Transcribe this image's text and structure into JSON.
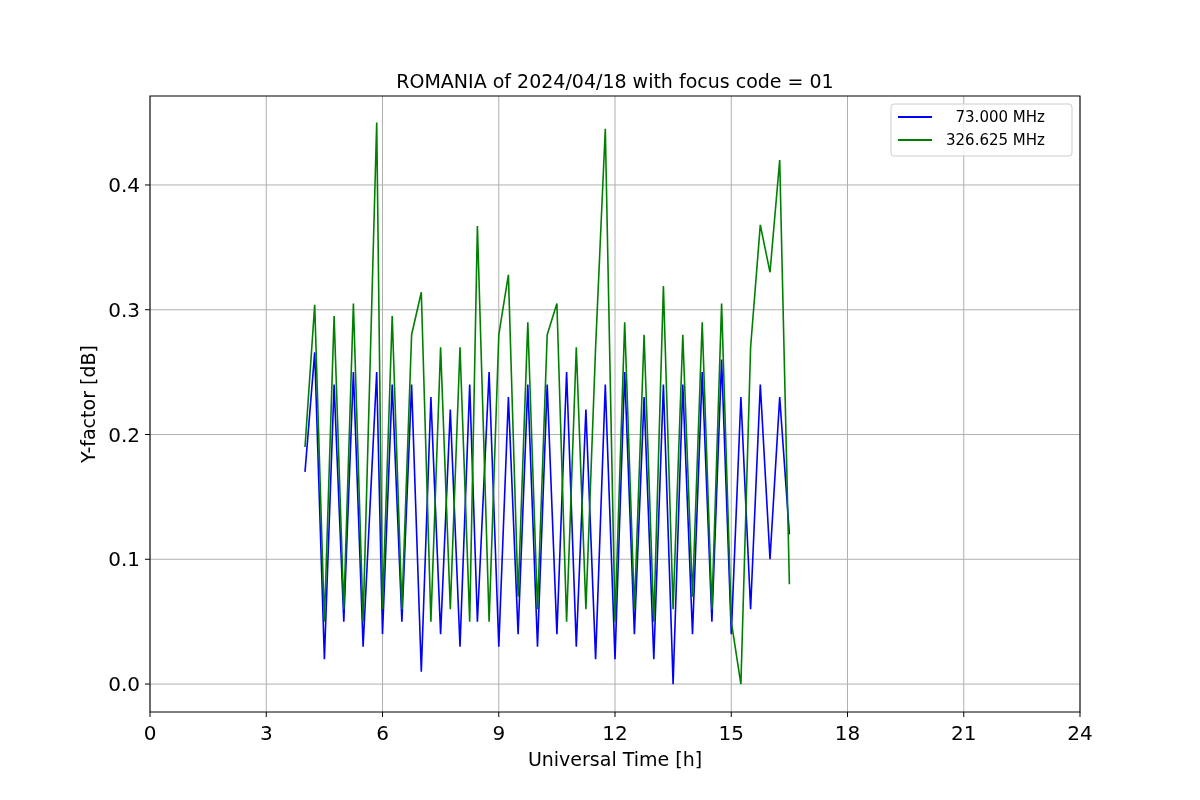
{
  "chart_data": {
    "type": "line",
    "title": "ROMANIA of 2024/04/18 with focus code = 01",
    "xlabel": "Universal Time [h]",
    "ylabel": "Y-factor [dB]",
    "x": [
      4.0,
      4.25,
      4.5,
      4.75,
      5.0,
      5.25,
      5.5,
      5.85,
      6.0,
      6.25,
      6.5,
      6.75,
      7.0,
      7.25,
      7.5,
      7.75,
      8.0,
      8.25,
      8.45,
      8.75,
      9.0,
      9.25,
      9.5,
      9.75,
      10.0,
      10.25,
      10.5,
      10.75,
      11.0,
      11.25,
      11.5,
      11.75,
      12.0,
      12.25,
      12.5,
      12.75,
      13.0,
      13.25,
      13.5,
      13.75,
      14.0,
      14.25,
      14.5,
      14.75,
      15.0,
      15.25,
      15.5,
      15.75,
      16.0,
      16.25,
      16.5
    ],
    "series": [
      {
        "name": "  73.000 MHz",
        "color": "#0000ff",
        "values": [
          0.17,
          0.266,
          0.02,
          0.24,
          0.05,
          0.25,
          0.03,
          0.25,
          0.04,
          0.24,
          0.05,
          0.24,
          0.01,
          0.23,
          0.04,
          0.22,
          0.03,
          0.24,
          0.05,
          0.25,
          0.03,
          0.23,
          0.04,
          0.24,
          0.03,
          0.24,
          0.04,
          0.25,
          0.03,
          0.22,
          0.02,
          0.24,
          0.02,
          0.25,
          0.04,
          0.23,
          0.02,
          0.24,
          0.0,
          0.24,
          0.04,
          0.25,
          0.05,
          0.26,
          0.04,
          0.23,
          0.06,
          0.24,
          0.1,
          0.23,
          0.12
        ]
      },
      {
        "name": "326.625 MHz",
        "color": "#008000",
        "values": [
          0.19,
          0.304,
          0.05,
          0.295,
          0.06,
          0.305,
          0.05,
          0.45,
          0.06,
          0.295,
          0.06,
          0.28,
          0.314,
          0.05,
          0.27,
          0.06,
          0.27,
          0.05,
          0.367,
          0.05,
          0.28,
          0.328,
          0.07,
          0.29,
          0.06,
          0.28,
          0.305,
          0.05,
          0.27,
          0.06,
          0.27,
          0.445,
          0.05,
          0.29,
          0.06,
          0.28,
          0.05,
          0.319,
          0.06,
          0.28,
          0.07,
          0.29,
          0.06,
          0.305,
          0.05,
          0.0,
          0.27,
          0.368,
          0.33,
          0.42,
          0.08
        ]
      }
    ],
    "xlim": [
      0,
      24
    ],
    "ylim": [
      -0.0224,
      0.4713
    ],
    "xticks": [
      {
        "value": 0,
        "label": "0"
      },
      {
        "value": 3,
        "label": "3"
      },
      {
        "value": 6,
        "label": "6"
      },
      {
        "value": 9,
        "label": "9"
      },
      {
        "value": 12,
        "label": "12"
      },
      {
        "value": 15,
        "label": "15"
      },
      {
        "value": 18,
        "label": "18"
      },
      {
        "value": 21,
        "label": "21"
      },
      {
        "value": 24,
        "label": "24"
      }
    ],
    "grid": true,
    "legend": "upper right",
    "yticks": [
      {
        "value": 0,
        "label": "0.0"
      },
      {
        "value": 0.1,
        "label": "0.1"
      },
      {
        "value": 0.2,
        "label": "0.2"
      },
      {
        "value": 0.3,
        "label": "0.3"
      },
      {
        "value": 0.4,
        "label": "0.4"
      }
    ]
  }
}
